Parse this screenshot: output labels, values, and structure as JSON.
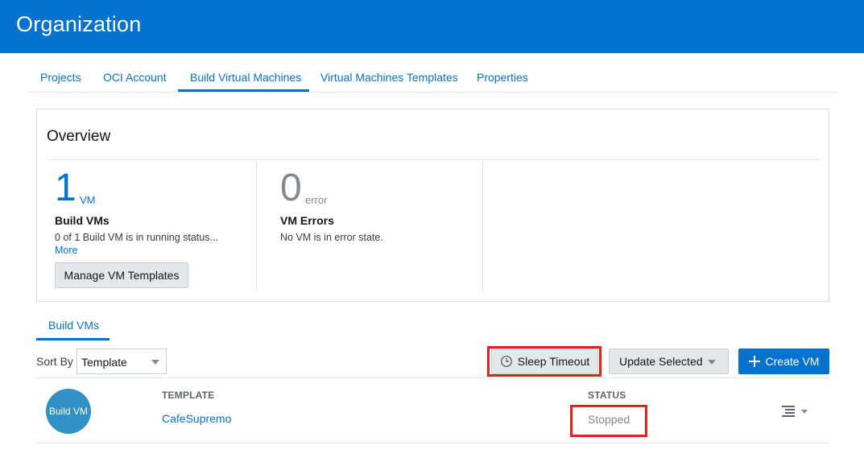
{
  "header": {
    "title": "Organization",
    "bg_color": "#0572ce"
  },
  "tabs": [
    {
      "label": "Projects"
    },
    {
      "label": "OCI Account"
    },
    {
      "label": "Build Virtual Machines",
      "active": true
    },
    {
      "label": "Virtual Machines Templates"
    },
    {
      "label": "Properties"
    }
  ],
  "overview": {
    "title": "Overview",
    "build_vms": {
      "count": "1",
      "unit": "VM",
      "label": "Build VMs",
      "description": "0 of 1 Build VM is in running status...",
      "more_link": "More",
      "button": "Manage VM Templates"
    },
    "vm_errors": {
      "count": "0",
      "unit": "error",
      "label": "VM Errors",
      "description": "No VM is in error state."
    }
  },
  "subtab": {
    "label": "Build VMs"
  },
  "toolbar": {
    "sort_label": "Sort By",
    "sort_value": "Template",
    "sleep_timeout": "Sleep Timeout",
    "update_selected": "Update Selected",
    "create_vm": "Create VM"
  },
  "table": {
    "columns": {
      "template": "TEMPLATE",
      "status": "STATUS"
    },
    "rows": [
      {
        "avatar": "Build VM",
        "template": "CafeSupremo",
        "status": "Stopped"
      }
    ]
  },
  "colors": {
    "accent": "#0572ce",
    "highlight": "#e5211c",
    "avatar": "#3191c4"
  }
}
